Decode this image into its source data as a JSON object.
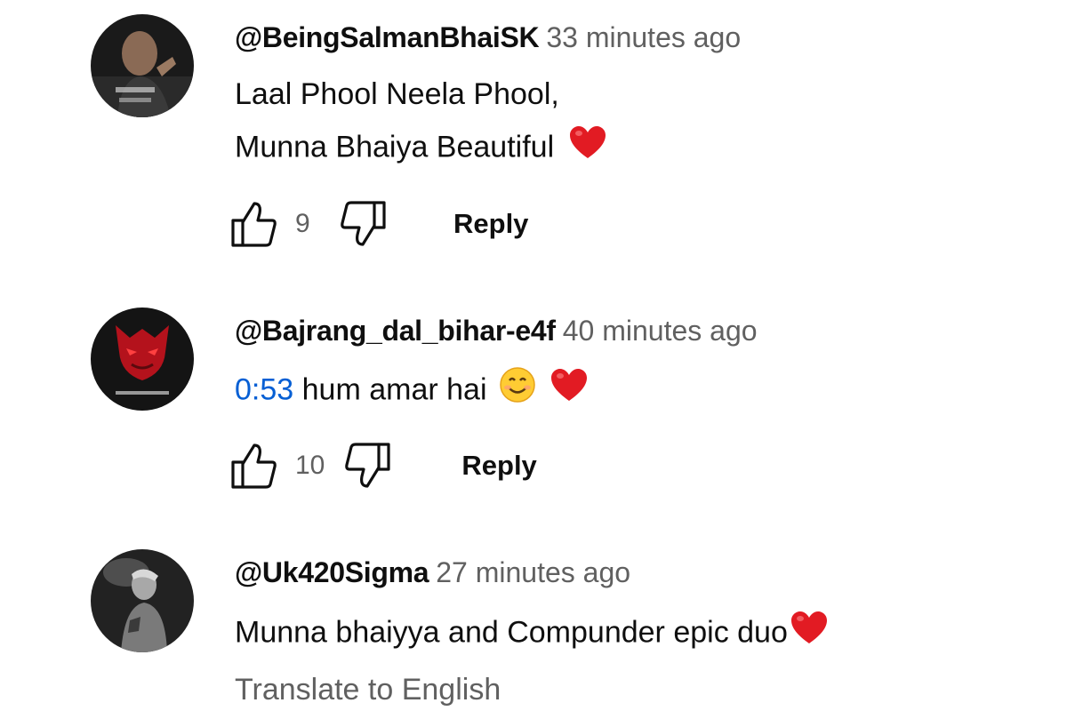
{
  "comments": [
    {
      "author": "@BeingSalmanBhaiSK",
      "time": "33 minutes ago",
      "line1": "Laal Phool Neela Phool,",
      "line2": "Munna Bhaiya Beautiful",
      "likes": "9",
      "reply_label": "Reply",
      "avatar_icon": "avatar-man-pointing"
    },
    {
      "author": "@Bajrang_dal_bihar-e4f",
      "time": "40 minutes ago",
      "timestamp_link": "0:53",
      "text": " hum amar hai",
      "likes": "10",
      "reply_label": "Reply",
      "avatar_icon": "avatar-red-face"
    },
    {
      "author": "@Uk420Sigma",
      "time": "27 minutes ago",
      "text": "Munna bhaiyya and Compunder epic duo",
      "translate_label": "Translate to English",
      "avatar_icon": "avatar-grey-figure"
    }
  ],
  "colors": {
    "link": "#065fd4",
    "secondary_text": "#606060",
    "heart": "#e21b23"
  },
  "icons": [
    "thumbs-up-icon",
    "thumbs-down-icon",
    "red-heart-emoji",
    "smiling-face-emoji"
  ]
}
